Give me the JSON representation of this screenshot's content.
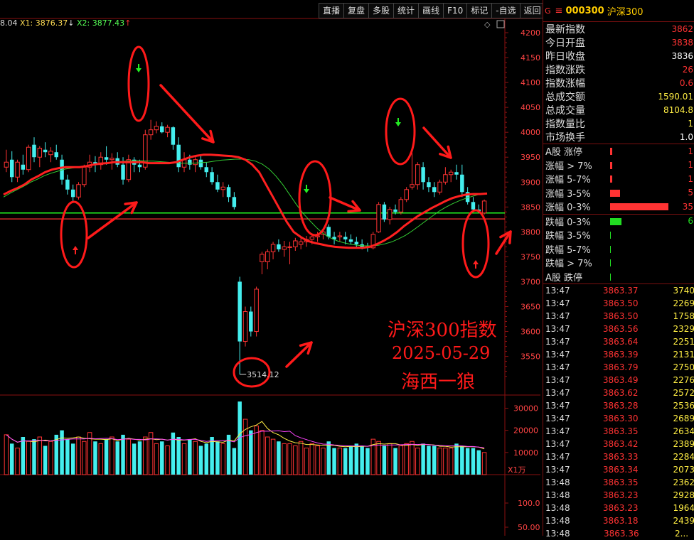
{
  "toolbar": [
    "直播",
    "复盘",
    "多股",
    "统计",
    "画线",
    "F10",
    "标记",
    "-自选",
    "返回"
  ],
  "legend": {
    "ma_first": "8.04",
    "x1": "X1: 3876.37",
    "x1_arrow": "↓",
    "x2": "X2: 3877.43",
    "x2_arrow": "↑"
  },
  "annotation": {
    "line1": "沪深300指数",
    "line2": "2025-05-29",
    "line3": "海西一狼"
  },
  "colors": {
    "up": "#ff3333",
    "down": "#44eeee",
    "ma1": "#ff2020",
    "ma2": "#33cc33",
    "flat": "#22ff22",
    "annot": "#ff1a1a"
  },
  "panel": {
    "marker": "G",
    "code": "000300",
    "name": "沪深300",
    "stats": [
      {
        "label": "最新指数",
        "value": "3862",
        "color": "red"
      },
      {
        "label": "今日开盘",
        "value": "3838",
        "color": "red"
      },
      {
        "label": "昨日收盘",
        "value": "3836",
        "color": "wht"
      },
      {
        "label": "指数涨跌",
        "value": "26",
        "color": "red"
      },
      {
        "label": "指数涨幅",
        "value": "0.6",
        "color": "red"
      },
      {
        "label": "总成交额",
        "value": "1590.01",
        "color": "yel"
      },
      {
        "label": "总成交量",
        "value": "8104.8",
        "color": "yel"
      },
      {
        "label": "指数量比",
        "value": "1",
        "color": "yel"
      },
      {
        "label": "市场换手",
        "value": "1.0",
        "color": "wht"
      }
    ],
    "breadth_up": [
      {
        "label": "A股 涨停",
        "value": "1",
        "bar": 3
      },
      {
        "label": "涨幅 > 7%",
        "value": "1",
        "bar": 3
      },
      {
        "label": "涨幅 5-7%",
        "value": "1",
        "bar": 3
      },
      {
        "label": "涨幅 3-5%",
        "value": "5",
        "bar": 14
      },
      {
        "label": "涨幅 0-3%",
        "value": "35",
        "bar": 82
      }
    ],
    "breadth_down": [
      {
        "label": "跌幅 0-3%",
        "value": "6",
        "bar": 16
      },
      {
        "label": "跌幅 3-5%",
        "value": "",
        "bar": 1
      },
      {
        "label": "跌幅 5-7%",
        "value": "",
        "bar": 1
      },
      {
        "label": "跌幅 > 7%",
        "value": "",
        "bar": 1
      },
      {
        "label": "A股 跌停",
        "value": "",
        "bar": 1
      }
    ],
    "ticks": [
      {
        "t": "13:47",
        "p": "3863.37",
        "v": "3740"
      },
      {
        "t": "13:47",
        "p": "3863.50",
        "v": "2269"
      },
      {
        "t": "13:47",
        "p": "3863.50",
        "v": "1758"
      },
      {
        "t": "13:47",
        "p": "3863.56",
        "v": "2329"
      },
      {
        "t": "13:47",
        "p": "3863.64",
        "v": "2251"
      },
      {
        "t": "13:47",
        "p": "3863.39",
        "v": "2131"
      },
      {
        "t": "13:47",
        "p": "3863.79",
        "v": "2750"
      },
      {
        "t": "13:47",
        "p": "3863.49",
        "v": "2276"
      },
      {
        "t": "13:47",
        "p": "3863.62",
        "v": "2572"
      },
      {
        "t": "13:47",
        "p": "3863.28",
        "v": "2536"
      },
      {
        "t": "13:47",
        "p": "3863.30",
        "v": "2689"
      },
      {
        "t": "13:47",
        "p": "3863.35",
        "v": "2634"
      },
      {
        "t": "13:47",
        "p": "3863.42",
        "v": "2389"
      },
      {
        "t": "13:47",
        "p": "3863.33",
        "v": "2284"
      },
      {
        "t": "13:47",
        "p": "3863.34",
        "v": "2073"
      },
      {
        "t": "13:48",
        "p": "3863.35",
        "v": "2362"
      },
      {
        "t": "13:48",
        "p": "3863.23",
        "v": "2928"
      },
      {
        "t": "13:48",
        "p": "3863.23",
        "v": "1964"
      },
      {
        "t": "13:48",
        "p": "3863.18",
        "v": "2439"
      },
      {
        "t": "13:48",
        "p": "3863.36",
        "v": "2..."
      }
    ]
  },
  "chart_data": {
    "type": "candlestick",
    "price_axis": {
      "min": 3500,
      "max": 4220,
      "ticks": [
        4200,
        4150,
        4100,
        4050,
        4000,
        3950,
        3900,
        3850,
        3800,
        3750,
        3700,
        3650,
        3600,
        3550
      ]
    },
    "volume_axis": {
      "min": 0,
      "max": 34000,
      "ticks": [
        30000,
        20000,
        10000
      ],
      "unit": "X1万"
    },
    "lower_axis": {
      "ticks": [
        "100.0",
        "50.00"
      ]
    },
    "low_label": "3514.12",
    "reference_lines": [
      3838,
      3826
    ],
    "candles": [
      {
        "o": 3930,
        "h": 3965,
        "l": 3920,
        "c": 3940
      },
      {
        "o": 3945,
        "h": 3962,
        "l": 3900,
        "c": 3910
      },
      {
        "o": 3910,
        "h": 3945,
        "l": 3900,
        "c": 3940
      },
      {
        "o": 3935,
        "h": 3955,
        "l": 3915,
        "c": 3925
      },
      {
        "o": 3925,
        "h": 3975,
        "l": 3920,
        "c": 3970
      },
      {
        "o": 3975,
        "h": 3990,
        "l": 3940,
        "c": 3950
      },
      {
        "o": 3950,
        "h": 3972,
        "l": 3930,
        "c": 3968
      },
      {
        "o": 3965,
        "h": 3980,
        "l": 3950,
        "c": 3960
      },
      {
        "o": 3955,
        "h": 3970,
        "l": 3940,
        "c": 3962
      },
      {
        "o": 3960,
        "h": 3975,
        "l": 3945,
        "c": 3950
      },
      {
        "o": 3945,
        "h": 3955,
        "l": 3895,
        "c": 3905
      },
      {
        "o": 3905,
        "h": 3915,
        "l": 3875,
        "c": 3885
      },
      {
        "o": 3885,
        "h": 3895,
        "l": 3858,
        "c": 3870
      },
      {
        "o": 3870,
        "h": 3900,
        "l": 3865,
        "c": 3895
      },
      {
        "o": 3895,
        "h": 3935,
        "l": 3890,
        "c": 3930
      },
      {
        "o": 3930,
        "h": 3955,
        "l": 3920,
        "c": 3940
      },
      {
        "o": 3940,
        "h": 3952,
        "l": 3920,
        "c": 3935
      },
      {
        "o": 3935,
        "h": 3960,
        "l": 3925,
        "c": 3950
      },
      {
        "o": 3950,
        "h": 3972,
        "l": 3935,
        "c": 3945
      },
      {
        "o": 3945,
        "h": 3958,
        "l": 3925,
        "c": 3948
      },
      {
        "o": 3948,
        "h": 3960,
        "l": 3930,
        "c": 3935
      },
      {
        "o": 3935,
        "h": 3950,
        "l": 3895,
        "c": 3905
      },
      {
        "o": 3905,
        "h": 3955,
        "l": 3900,
        "c": 3945
      },
      {
        "o": 3945,
        "h": 3950,
        "l": 3920,
        "c": 3935
      },
      {
        "o": 3935,
        "h": 3945,
        "l": 3920,
        "c": 3930
      },
      {
        "o": 3930,
        "h": 4005,
        "l": 3925,
        "c": 3995
      },
      {
        "o": 3995,
        "h": 4025,
        "l": 3985,
        "c": 4005
      },
      {
        "o": 4005,
        "h": 4022,
        "l": 3998,
        "c": 4012
      },
      {
        "o": 4012,
        "h": 4020,
        "l": 3998,
        "c": 4000
      },
      {
        "o": 4000,
        "h": 4015,
        "l": 3990,
        "c": 4010
      },
      {
        "o": 4010,
        "h": 4012,
        "l": 3965,
        "c": 3975
      },
      {
        "o": 3975,
        "h": 3990,
        "l": 3920,
        "c": 3930
      },
      {
        "o": 3930,
        "h": 3960,
        "l": 3920,
        "c": 3945
      },
      {
        "o": 3945,
        "h": 3955,
        "l": 3925,
        "c": 3935
      },
      {
        "o": 3935,
        "h": 3950,
        "l": 3920,
        "c": 3945
      },
      {
        "o": 3945,
        "h": 3952,
        "l": 3925,
        "c": 3930
      },
      {
        "o": 3930,
        "h": 3940,
        "l": 3910,
        "c": 3920
      },
      {
        "o": 3920,
        "h": 3930,
        "l": 3895,
        "c": 3900
      },
      {
        "o": 3900,
        "h": 3915,
        "l": 3880,
        "c": 3885
      },
      {
        "o": 3885,
        "h": 3900,
        "l": 3870,
        "c": 3890
      },
      {
        "o": 3890,
        "h": 3895,
        "l": 3860,
        "c": 3870
      },
      {
        "o": 3870,
        "h": 3880,
        "l": 3845,
        "c": 3850
      },
      {
        "o": 3700,
        "h": 3710,
        "l": 3514,
        "c": 3580
      },
      {
        "o": 3580,
        "h": 3650,
        "l": 3570,
        "c": 3640
      },
      {
        "o": 3640,
        "h": 3650,
        "l": 3590,
        "c": 3600
      },
      {
        "o": 3600,
        "h": 3690,
        "l": 3590,
        "c": 3685
      },
      {
        "o": 3740,
        "h": 3760,
        "l": 3715,
        "c": 3755
      },
      {
        "o": 3740,
        "h": 3765,
        "l": 3725,
        "c": 3760
      },
      {
        "o": 3760,
        "h": 3780,
        "l": 3745,
        "c": 3775
      },
      {
        "o": 3775,
        "h": 3785,
        "l": 3760,
        "c": 3765
      },
      {
        "o": 3765,
        "h": 3782,
        "l": 3750,
        "c": 3770
      },
      {
        "o": 3770,
        "h": 3780,
        "l": 3735,
        "c": 3770
      },
      {
        "o": 3770,
        "h": 3788,
        "l": 3762,
        "c": 3782
      },
      {
        "o": 3775,
        "h": 3790,
        "l": 3765,
        "c": 3780
      },
      {
        "o": 3780,
        "h": 3792,
        "l": 3770,
        "c": 3785
      },
      {
        "o": 3785,
        "h": 3795,
        "l": 3775,
        "c": 3790
      },
      {
        "o": 3790,
        "h": 3800,
        "l": 3780,
        "c": 3792
      },
      {
        "o": 3795,
        "h": 3805,
        "l": 3785,
        "c": 3800
      },
      {
        "o": 3810,
        "h": 3815,
        "l": 3785,
        "c": 3790
      },
      {
        "o": 3790,
        "h": 3800,
        "l": 3775,
        "c": 3785
      },
      {
        "o": 3790,
        "h": 3800,
        "l": 3780,
        "c": 3792
      },
      {
        "o": 3790,
        "h": 3800,
        "l": 3775,
        "c": 3785
      },
      {
        "o": 3785,
        "h": 3795,
        "l": 3775,
        "c": 3780
      },
      {
        "o": 3780,
        "h": 3790,
        "l": 3770,
        "c": 3775
      },
      {
        "o": 3775,
        "h": 3785,
        "l": 3765,
        "c": 3770
      },
      {
        "o": 3770,
        "h": 3778,
        "l": 3760,
        "c": 3768
      },
      {
        "o": 3768,
        "h": 3800,
        "l": 3765,
        "c": 3795
      },
      {
        "o": 3800,
        "h": 3860,
        "l": 3798,
        "c": 3855
      },
      {
        "o": 3855,
        "h": 3860,
        "l": 3820,
        "c": 3825
      },
      {
        "o": 3825,
        "h": 3850,
        "l": 3815,
        "c": 3845
      },
      {
        "o": 3845,
        "h": 3855,
        "l": 3835,
        "c": 3840
      },
      {
        "o": 3840,
        "h": 3870,
        "l": 3835,
        "c": 3865
      },
      {
        "o": 3865,
        "h": 3890,
        "l": 3860,
        "c": 3885
      },
      {
        "o": 3890,
        "h": 3960,
        "l": 3885,
        "c": 3895
      },
      {
        "o": 3895,
        "h": 3940,
        "l": 3885,
        "c": 3935
      },
      {
        "o": 3930,
        "h": 3940,
        "l": 3885,
        "c": 3900
      },
      {
        "o": 3900,
        "h": 3910,
        "l": 3880,
        "c": 3890
      },
      {
        "o": 3890,
        "h": 3900,
        "l": 3870,
        "c": 3880
      },
      {
        "o": 3880,
        "h": 3905,
        "l": 3875,
        "c": 3900
      },
      {
        "o": 3900,
        "h": 3930,
        "l": 3895,
        "c": 3915
      },
      {
        "o": 3915,
        "h": 3925,
        "l": 3900,
        "c": 3920
      },
      {
        "o": 3920,
        "h": 3935,
        "l": 3905,
        "c": 3915
      },
      {
        "o": 3915,
        "h": 3935,
        "l": 3870,
        "c": 3880
      },
      {
        "o": 3880,
        "h": 3890,
        "l": 3855,
        "c": 3860
      },
      {
        "o": 3860,
        "h": 3870,
        "l": 3840,
        "c": 3845
      },
      {
        "o": 3845,
        "h": 3855,
        "l": 3838,
        "c": 3842
      },
      {
        "o": 3838,
        "h": 3865,
        "l": 3835,
        "c": 3862
      }
    ],
    "ma_red": [
      3875,
      3882,
      3888,
      3895,
      3905,
      3912,
      3920,
      3925,
      3928,
      3930,
      3930,
      3930,
      3932,
      3935,
      3937,
      3938,
      3940,
      3940,
      3940,
      3940,
      3940,
      3938,
      3938,
      3938,
      3938,
      3940,
      3945,
      3950,
      3953,
      3955,
      3955,
      3954,
      3953,
      3952,
      3950,
      3945,
      3935,
      3920,
      3895,
      3870,
      3845,
      3820,
      3800,
      3790,
      3782,
      3778,
      3775,
      3772,
      3770,
      3769,
      3768,
      3768,
      3768,
      3770,
      3775,
      3782,
      3790,
      3800,
      3812,
      3822,
      3832,
      3840,
      3848,
      3855,
      3862,
      3868,
      3872,
      3875,
      3876,
      3876,
      3877
    ],
    "ma_green": [
      3870,
      3878,
      3885,
      3892,
      3900,
      3906,
      3913,
      3918,
      3922,
      3926,
      3928,
      3930,
      3932,
      3935,
      3937,
      3938,
      3940,
      3941,
      3942,
      3943,
      3943,
      3942,
      3942,
      3941,
      3940,
      3939,
      3938,
      3938,
      3938,
      3939,
      3940,
      3942,
      3944,
      3945,
      3946,
      3946,
      3945,
      3942,
      3936,
      3926,
      3912,
      3895,
      3875,
      3855,
      3837,
      3822,
      3808,
      3796,
      3788,
      3782,
      3778,
      3775,
      3773,
      3772,
      3772,
      3773,
      3776,
      3780,
      3786,
      3793,
      3802,
      3812,
      3822,
      3832,
      3842,
      3850,
      3857,
      3863,
      3868,
      3872,
      3876,
      3878
    ],
    "volume": [
      18000,
      14000,
      12000,
      17000,
      15000,
      16000,
      17000,
      13000,
      15000,
      18000,
      20000,
      16000,
      14000,
      17000,
      15000,
      19000,
      15000,
      14000,
      16000,
      17000,
      15000,
      18000,
      16000,
      14000,
      15000,
      17000,
      19000,
      14000,
      15000,
      13000,
      19000,
      17000,
      14000,
      16000,
      15000,
      13000,
      14000,
      17000,
      15000,
      14000,
      18000,
      12000,
      33000,
      25000,
      20000,
      22000,
      20000,
      17000,
      16000,
      15000,
      14000,
      14000,
      13000,
      15000,
      12000,
      14000,
      13000,
      12000,
      15000,
      12000,
      12000,
      12000,
      13000,
      14000,
      13000,
      12000,
      16000,
      15000,
      13000,
      14000,
      12000,
      13000,
      14000,
      15000,
      12000,
      14000,
      13000,
      13000,
      12000,
      12000,
      12000,
      14000,
      13000,
      12000,
      12000,
      11000,
      10000
    ]
  }
}
